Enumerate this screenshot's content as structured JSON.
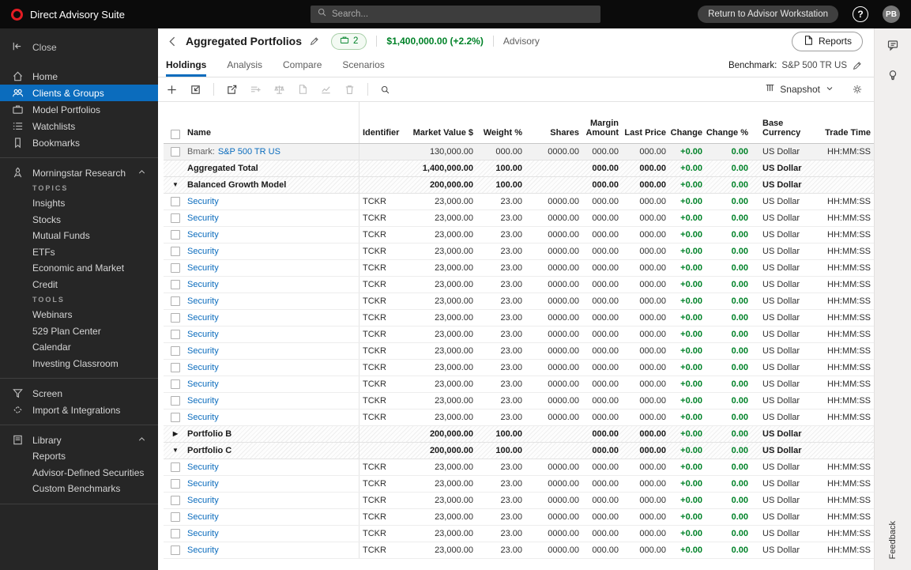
{
  "colors": {
    "accent_blue": "#0b6cbd",
    "positive_green": "#008228",
    "brand_red": "#e31c23"
  },
  "topbar": {
    "brand": "Direct Advisory Suite",
    "search_placeholder": "Search...",
    "return_button": "Return to Advisor Workstation",
    "avatar": "PB"
  },
  "sidebar": {
    "close_label": "Close",
    "groups": [
      {
        "items": [
          {
            "type": "item",
            "label": "Home",
            "icon": "home"
          },
          {
            "type": "item",
            "label": "Clients & Groups",
            "icon": "users",
            "active": true
          },
          {
            "type": "item",
            "label": "Model Portfolios",
            "icon": "briefcase"
          },
          {
            "type": "item",
            "label": "Watchlists",
            "icon": "watchlist"
          },
          {
            "type": "item",
            "label": "Bookmarks",
            "icon": "bookmark"
          }
        ]
      },
      {
        "items": [
          {
            "type": "item",
            "label": "Morningstar Research",
            "icon": "research",
            "chevron": "up"
          },
          {
            "type": "sublabel",
            "label": "TOPICS"
          },
          {
            "type": "sub",
            "label": "Insights"
          },
          {
            "type": "sub",
            "label": "Stocks"
          },
          {
            "type": "sub",
            "label": "Mutual Funds"
          },
          {
            "type": "sub",
            "label": "ETFs"
          },
          {
            "type": "sub",
            "label": "Economic and Market"
          },
          {
            "type": "sub",
            "label": "Credit"
          },
          {
            "type": "sublabel",
            "label": "TOOLS"
          },
          {
            "type": "sub",
            "label": "Webinars"
          },
          {
            "type": "sub",
            "label": "529 Plan Center"
          },
          {
            "type": "sub",
            "label": "Calendar"
          },
          {
            "type": "sub",
            "label": "Investing Classroom"
          }
        ]
      },
      {
        "items": [
          {
            "type": "item",
            "label": "Screen",
            "icon": "screen"
          },
          {
            "type": "item",
            "label": "Import & Integrations",
            "icon": "integrations"
          }
        ]
      },
      {
        "items": [
          {
            "type": "item",
            "label": "Library",
            "icon": "library",
            "chevron": "up"
          },
          {
            "type": "sub",
            "label": "Reports"
          },
          {
            "type": "sub",
            "label": "Advisor-Defined Securities"
          },
          {
            "type": "sub",
            "label": "Custom Benchmarks"
          }
        ]
      }
    ]
  },
  "page": {
    "title": "Aggregated Portfolios",
    "badge_count": "2",
    "value_text": "$1,400,000.00 (+2.2%)",
    "type_label": "Advisory",
    "reports_button": "Reports"
  },
  "tabs": [
    {
      "label": "Holdings",
      "active": true
    },
    {
      "label": "Analysis",
      "active": false
    },
    {
      "label": "Compare",
      "active": false
    },
    {
      "label": "Scenarios",
      "active": false
    }
  ],
  "benchmark": {
    "label": "Benchmark:",
    "value": "S&P 500 TR US"
  },
  "toolbar": {
    "snapshot_label": "Snapshot",
    "buttons": [
      {
        "name": "add",
        "enabled": true
      },
      {
        "name": "import",
        "enabled": true
      },
      {
        "name": "sep"
      },
      {
        "name": "export",
        "enabled": true
      },
      {
        "name": "add-to-list",
        "enabled": false
      },
      {
        "name": "rebalance",
        "enabled": false
      },
      {
        "name": "report",
        "enabled": false
      },
      {
        "name": "chart",
        "enabled": false
      },
      {
        "name": "delete",
        "enabled": false
      },
      {
        "name": "sep"
      },
      {
        "name": "search",
        "enabled": true
      }
    ]
  },
  "table": {
    "columns": [
      {
        "key": "name",
        "label": "Name",
        "align": "left"
      },
      {
        "key": "identifier",
        "label": "Identifier",
        "align": "left"
      },
      {
        "key": "market_value",
        "label": "Market Value $",
        "align": "right"
      },
      {
        "key": "weight",
        "label": "Weight %",
        "align": "right"
      },
      {
        "key": "shares",
        "label": "Shares",
        "align": "right"
      },
      {
        "key": "margin",
        "label": "Margin Amount",
        "align": "right"
      },
      {
        "key": "last_price",
        "label": "Last Price",
        "align": "right"
      },
      {
        "key": "change",
        "label": "Change",
        "align": "right",
        "green": true
      },
      {
        "key": "change_pct",
        "label": "Change %",
        "align": "right",
        "green": true
      },
      {
        "key": "currency",
        "label": "Base Currency",
        "align": "left"
      },
      {
        "key": "trade_time",
        "label": "Trade Time",
        "align": "right"
      }
    ],
    "security_row": {
      "name": "Security",
      "identifier": "TCKR",
      "market_value": "23,000.00",
      "weight": "23.00",
      "shares": "0000.00",
      "margin": "000.00",
      "last_price": "000.00",
      "change": "+0.00",
      "change_pct": "0.00",
      "currency": "US Dollar",
      "trade_time": "HH:MM:SS"
    },
    "rows": [
      {
        "type": "benchmark",
        "prefix": "Bmark: ",
        "name": "S&P 500 TR US",
        "identifier": "",
        "market_value": "130,000.00",
        "weight": "000.00",
        "shares": "0000.00",
        "margin": "000.00",
        "last_price": "000.00",
        "change": "+0.00",
        "change_pct": "0.00",
        "currency": "US Dollar",
        "trade_time": "HH:MM:SS"
      },
      {
        "type": "total",
        "name": "Aggregated Total",
        "identifier": "",
        "market_value": "1,400,000.00",
        "weight": "100.00",
        "shares": "",
        "margin": "000.00",
        "last_price": "000.00",
        "change": "+0.00",
        "change_pct": "0.00",
        "currency": "US Dollar",
        "trade_time": ""
      },
      {
        "type": "group",
        "expanded": true,
        "name": "Balanced Growth Model",
        "identifier": "",
        "market_value": "200,000.00",
        "weight": "100.00",
        "shares": "",
        "margin": "000.00",
        "last_price": "000.00",
        "change": "+0.00",
        "change_pct": "0.00",
        "currency": "US Dollar",
        "trade_time": ""
      },
      {
        "type": "security_repeat",
        "count": 14
      },
      {
        "type": "group",
        "expanded": false,
        "name": "Portfolio B",
        "identifier": "",
        "market_value": "200,000.00",
        "weight": "100.00",
        "shares": "",
        "margin": "000.00",
        "last_price": "000.00",
        "change": "+0.00",
        "change_pct": "0.00",
        "currency": "US Dollar",
        "trade_time": ""
      },
      {
        "type": "group",
        "expanded": true,
        "name": "Portfolio C",
        "identifier": "",
        "market_value": "200,000.00",
        "weight": "100.00",
        "shares": "",
        "margin": "000.00",
        "last_price": "000.00",
        "change": "+0.00",
        "change_pct": "0.00",
        "currency": "US Dollar",
        "trade_time": ""
      },
      {
        "type": "security_repeat",
        "count": 6
      }
    ]
  },
  "rail": {
    "feedback_label": "Feedback"
  }
}
